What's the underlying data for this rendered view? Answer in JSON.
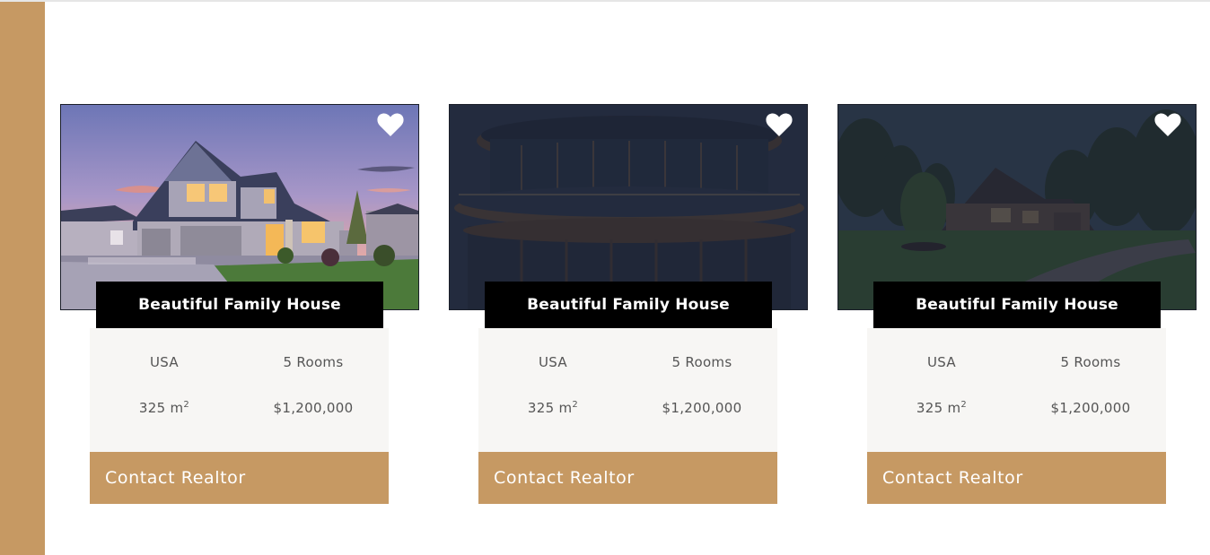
{
  "colors": {
    "accent": "#c69963",
    "card_bg": "#f7f6f4",
    "title_bg": "#000000",
    "overlay": "#1b2030"
  },
  "cards": [
    {
      "title": "Beautiful Family House",
      "country": "USA",
      "rooms": "5 Rooms",
      "area": "325 m",
      "area_unit_sup": "2",
      "price": "$1,200,000",
      "cta": "Contact Realtor",
      "favorite_icon": "heart-icon"
    },
    {
      "title": "Beautiful Family House",
      "country": "USA",
      "rooms": "5 Rooms",
      "area": "325 m",
      "area_unit_sup": "2",
      "price": "$1,200,000",
      "cta": "Contact Realtor",
      "favorite_icon": "heart-icon"
    },
    {
      "title": "Beautiful Family House",
      "country": "USA",
      "rooms": "5 Rooms",
      "area": "325 m",
      "area_unit_sup": "2",
      "price": "$1,200,000",
      "cta": "Contact Realtor",
      "favorite_icon": "heart-icon"
    }
  ]
}
